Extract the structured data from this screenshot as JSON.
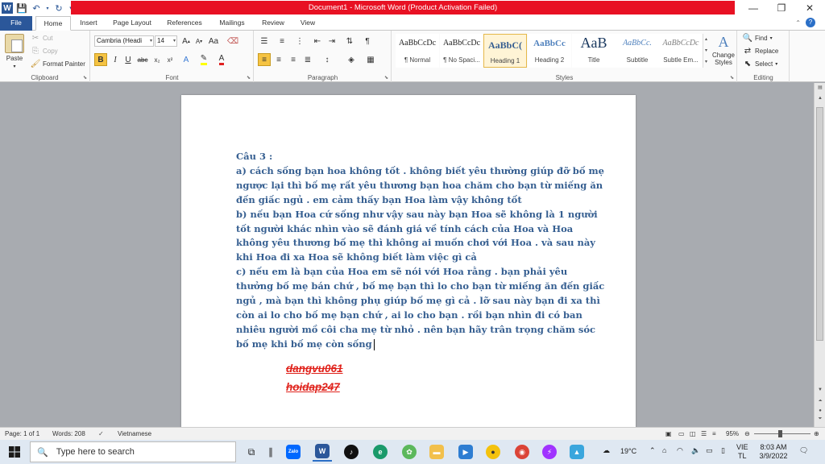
{
  "window": {
    "title": "Document1  -  Microsoft Word (Product Activation Failed)",
    "minimize": "—",
    "maximize": "❐",
    "close": "✕"
  },
  "ribbon_tabs": [
    "File",
    "Home",
    "Insert",
    "Page Layout",
    "References",
    "Mailings",
    "Review",
    "View"
  ],
  "clipboard": {
    "paste": "Paste",
    "cut": "Cut",
    "copy": "Copy",
    "format_painter": "Format Painter",
    "label": "Clipboard"
  },
  "font": {
    "name": "Cambria (Headi",
    "size": "14",
    "label": "Font"
  },
  "paragraph": {
    "label": "Paragraph"
  },
  "styles": {
    "label": "Styles",
    "items": [
      {
        "sample": "AaBbCcDc",
        "name": "¶ Normal"
      },
      {
        "sample": "AaBbCcDc",
        "name": "¶ No Spaci..."
      },
      {
        "sample": "AaBbC(",
        "name": "Heading 1"
      },
      {
        "sample": "AaBbCc",
        "name": "Heading 2"
      },
      {
        "sample": "AaB",
        "name": "Title"
      },
      {
        "sample": "AaBbCc.",
        "name": "Subtitle"
      },
      {
        "sample": "AaBbCcDc",
        "name": "Subtle Em..."
      }
    ],
    "change_styles": "Change Styles"
  },
  "editing": {
    "find": "Find",
    "replace": "Replace",
    "select": "Select",
    "label": "Editing"
  },
  "document": {
    "lines": [
      "Câu 3 :",
      "a) cách sống bạn hoa không tốt . không biết yêu thường giúp đỡ bố mẹ",
      "ngược lại thì bố mẹ rất yêu thương bạn hoa chăm cho bạn từ miếng ăn",
      "đến giấc ngủ . em cảm thấy bạn Hoa làm vậy không tốt",
      "b) nếu bạn Hoa cứ sống như vậy sau này bạn Hoa sẽ không là 1 người",
      "tốt người khác nhìn vào sẽ đánh giá về tính cách của Hoa và Hoa",
      "không yêu thương bố mẹ thì không ai muốn chơi với Hoa . và sau này",
      "khi Hoa đi xa Hoa sẽ không biết làm việc gì cả",
      "c) nếu em là bạn của Hoa em sẽ nói với Hoa rằng . bạn phải yêu",
      "thưởng bố mẹ bán chứ , bố mẹ bạn thì lo cho bạn từ miếng ăn đến giấc",
      "ngủ , mà bạn thì không phụ giúp bố mẹ gì cả . lỡ sau này bạn đi xa thì",
      "còn ai lo cho bố mẹ bạn chứ , ai lo cho bạn . rồi bạn nhìn đi có ban",
      "nhiêu người mồ côi cha mẹ từ nhỏ . nên bạn hãy trân trọng chăm sóc",
      "bố mẹ khi bố mẹ còn sống"
    ],
    "signature": [
      "dangvu061",
      "hoidap247"
    ]
  },
  "status": {
    "page": "Page: 1 of 1",
    "words": "Words: 208",
    "language": "Vietnamese",
    "zoom": "95%"
  },
  "taskbar": {
    "search_placeholder": "Type here to search",
    "weather": "19°C",
    "lang": [
      "VIE",
      "TL"
    ],
    "time": "8:03 AM",
    "date": "3/9/2022"
  }
}
